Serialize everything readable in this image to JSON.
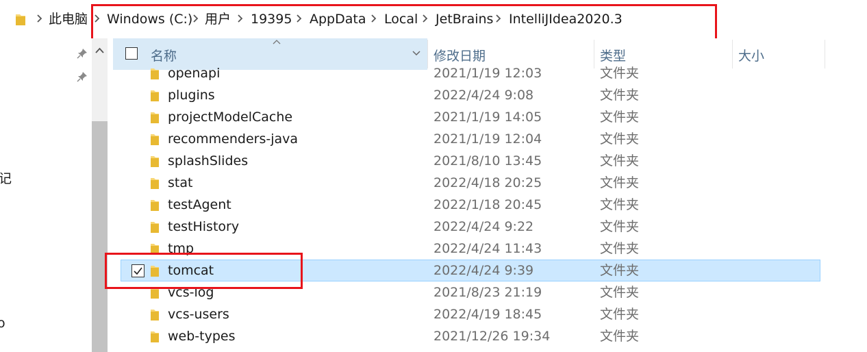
{
  "breadcrumb": {
    "items": [
      "此电脑",
      "Windows (C:)",
      "用户",
      "19395",
      "AppData",
      "Local",
      "JetBrains",
      "IntelliJIdea2020.3"
    ]
  },
  "nav": {
    "fragment_1": "记",
    "fragment_2": "o"
  },
  "columns": {
    "name": "名称",
    "date": "修改日期",
    "type": "类型",
    "size": "大小"
  },
  "rows": [
    {
      "name": "openapi",
      "date": "2021/1/19 12:03",
      "type": "文件夹",
      "size": ""
    },
    {
      "name": "plugins",
      "date": "2022/4/24 9:08",
      "type": "文件夹",
      "size": ""
    },
    {
      "name": "projectModelCache",
      "date": "2021/1/19 14:05",
      "type": "文件夹",
      "size": ""
    },
    {
      "name": "recommenders-java",
      "date": "2021/1/19 12:04",
      "type": "文件夹",
      "size": ""
    },
    {
      "name": "splashSlides",
      "date": "2021/8/10 13:45",
      "type": "文件夹",
      "size": ""
    },
    {
      "name": "stat",
      "date": "2022/4/18 20:25",
      "type": "文件夹",
      "size": ""
    },
    {
      "name": "testAgent",
      "date": "2022/1/18 20:45",
      "type": "文件夹",
      "size": ""
    },
    {
      "name": "testHistory",
      "date": "2022/4/24 9:22",
      "type": "文件夹",
      "size": ""
    },
    {
      "name": "tmp",
      "date": "2022/4/24 11:43",
      "type": "文件夹",
      "size": ""
    },
    {
      "name": "tomcat",
      "date": "2022/4/24 9:39",
      "type": "文件夹",
      "size": "",
      "selected": true
    },
    {
      "name": "vcs-log",
      "date": "2021/8/23 21:19",
      "type": "文件夹",
      "size": ""
    },
    {
      "name": "vcs-users",
      "date": "2022/4/19 18:45",
      "type": "文件夹",
      "size": ""
    },
    {
      "name": "web-types",
      "date": "2021/12/26 19:34",
      "type": "文件夹",
      "size": ""
    }
  ],
  "colors": {
    "selection": "#cce8ff",
    "header_highlight": "#d9eaf7",
    "annotation_red": "#e8141b",
    "folder_yellow": "#f8d775"
  }
}
